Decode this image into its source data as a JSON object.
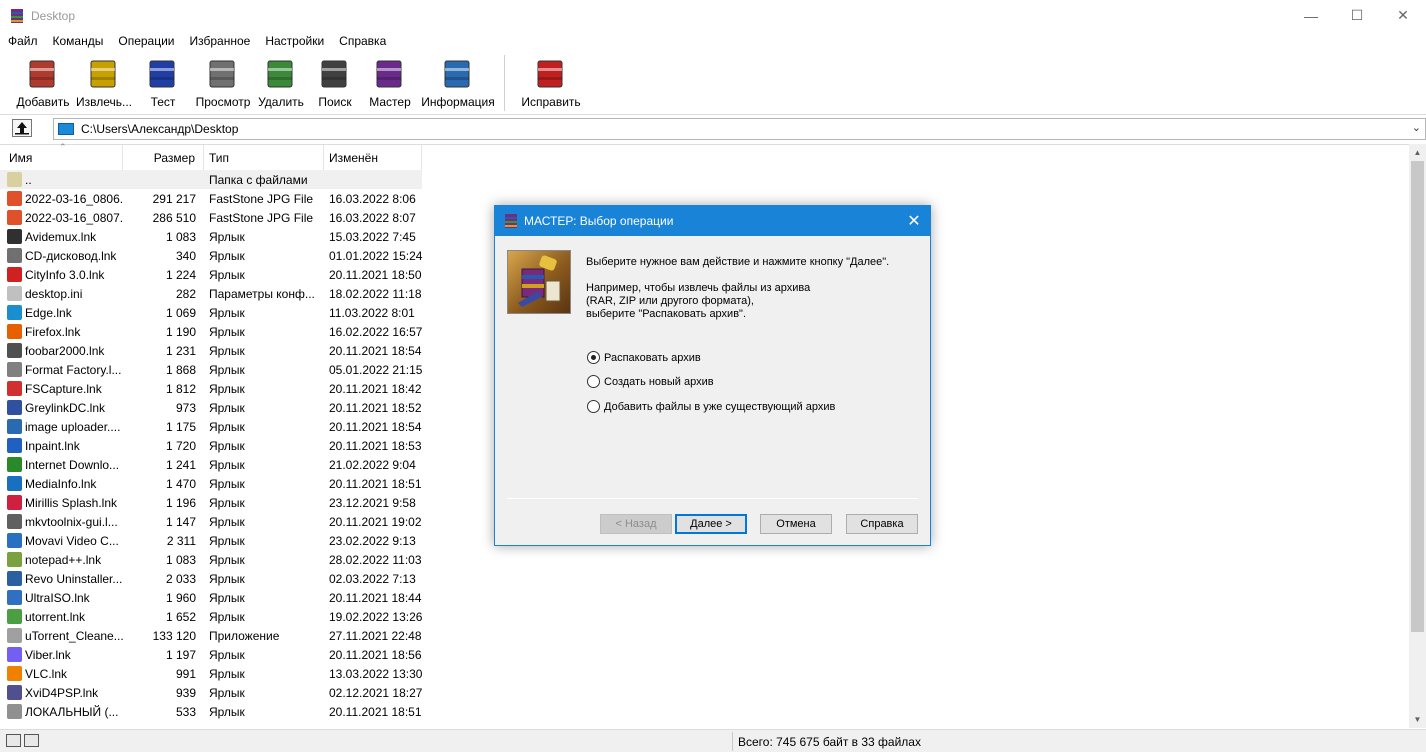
{
  "window": {
    "title": "Desktop",
    "minimize": "—",
    "maximize": "☐",
    "close": "✕"
  },
  "menu": [
    "Файл",
    "Команды",
    "Операции",
    "Избранное",
    "Настройки",
    "Справка"
  ],
  "toolbar": [
    {
      "label": "Добавить",
      "icon": "add-archive-icon",
      "color": "#b03a2e"
    },
    {
      "label": "Извлечь...",
      "icon": "extract-icon",
      "color": "#c8a000"
    },
    {
      "label": "Тест",
      "icon": "test-icon",
      "color": "#1f3fa6"
    },
    {
      "label": "Просмотр",
      "icon": "view-icon",
      "color": "#707070"
    },
    {
      "label": "Удалить",
      "icon": "delete-icon",
      "color": "#3a8a3a"
    },
    {
      "label": "Поиск",
      "icon": "find-icon",
      "color": "#404040"
    },
    {
      "label": "Мастер",
      "icon": "wizard-icon",
      "color": "#6a2a8a"
    },
    {
      "label": "Информация",
      "icon": "info-icon",
      "color": "#2a6ab0"
    },
    {
      "label": "Исправить",
      "icon": "repair-icon",
      "color": "#c02020"
    }
  ],
  "address": {
    "path": "C:\\Users\\Александр\\Desktop"
  },
  "columns": {
    "name": "Имя",
    "size": "Размер",
    "type": "Тип",
    "modified": "Изменён"
  },
  "files": [
    {
      "name": "..",
      "size": "",
      "type": "Папка с файлами",
      "modified": "",
      "color": "#d8d0a0"
    },
    {
      "name": "2022-03-16_0806...",
      "size": "291 217",
      "type": "FastStone JPG File",
      "modified": "16.03.2022 8:06",
      "color": "#e0502a"
    },
    {
      "name": "2022-03-16_0807...",
      "size": "286 510",
      "type": "FastStone JPG File",
      "modified": "16.03.2022 8:07",
      "color": "#e0502a"
    },
    {
      "name": "Avidemux.lnk",
      "size": "1 083",
      "type": "Ярлык",
      "modified": "15.03.2022 7:45",
      "color": "#303030"
    },
    {
      "name": "CD-дисковод.lnk",
      "size": "340",
      "type": "Ярлык",
      "modified": "01.01.2022 15:24",
      "color": "#707070"
    },
    {
      "name": "CityInfo 3.0.lnk",
      "size": "1 224",
      "type": "Ярлык",
      "modified": "20.11.2021 18:50",
      "color": "#d02020"
    },
    {
      "name": "desktop.ini",
      "size": "282",
      "type": "Параметры конф...",
      "modified": "18.02.2022 11:18",
      "color": "#c0c0c0"
    },
    {
      "name": "Edge.lnk",
      "size": "1 069",
      "type": "Ярлык",
      "modified": "11.03.2022 8:01",
      "color": "#1a8fd0"
    },
    {
      "name": "Firefox.lnk",
      "size": "1 190",
      "type": "Ярлык",
      "modified": "16.02.2022 16:57",
      "color": "#e66000"
    },
    {
      "name": "foobar2000.lnk",
      "size": "1 231",
      "type": "Ярлык",
      "modified": "20.11.2021 18:54",
      "color": "#505050"
    },
    {
      "name": "Format Factory.l...",
      "size": "1 868",
      "type": "Ярлык",
      "modified": "05.01.2022 21:15",
      "color": "#808080"
    },
    {
      "name": "FSCapture.lnk",
      "size": "1 812",
      "type": "Ярлык",
      "modified": "20.11.2021 18:42",
      "color": "#d03030"
    },
    {
      "name": "GreylinkDC.lnk",
      "size": "973",
      "type": "Ярлык",
      "modified": "20.11.2021 18:52",
      "color": "#3050a0"
    },
    {
      "name": "image uploader....",
      "size": "1 175",
      "type": "Ярлык",
      "modified": "20.11.2021 18:54",
      "color": "#2a6ab0"
    },
    {
      "name": "Inpaint.lnk",
      "size": "1 720",
      "type": "Ярлык",
      "modified": "20.11.2021 18:53",
      "color": "#1f60c0"
    },
    {
      "name": "Internet Downlo...",
      "size": "1 241",
      "type": "Ярлык",
      "modified": "21.02.2022 9:04",
      "color": "#2a8a2a"
    },
    {
      "name": "MediaInfo.lnk",
      "size": "1 470",
      "type": "Ярлык",
      "modified": "20.11.2021 18:51",
      "color": "#1a70c0"
    },
    {
      "name": "Mirillis Splash.lnk",
      "size": "1 196",
      "type": "Ярлык",
      "modified": "23.12.2021 9:58",
      "color": "#d02040"
    },
    {
      "name": "mkvtoolnix-gui.l...",
      "size": "1 147",
      "type": "Ярлык",
      "modified": "20.11.2021 19:02",
      "color": "#606060"
    },
    {
      "name": "Movavi Video C...",
      "size": "2 311",
      "type": "Ярлык",
      "modified": "23.02.2022 9:13",
      "color": "#2a70c0"
    },
    {
      "name": "notepad++.lnk",
      "size": "1 083",
      "type": "Ярлык",
      "modified": "28.02.2022 11:03",
      "color": "#7aa040"
    },
    {
      "name": "Revo Uninstaller....",
      "size": "2 033",
      "type": "Ярлык",
      "modified": "02.03.2022 7:13",
      "color": "#2a60a0"
    },
    {
      "name": "UltraISO.lnk",
      "size": "1 960",
      "type": "Ярлык",
      "modified": "20.11.2021 18:44",
      "color": "#3070c0"
    },
    {
      "name": "utorrent.lnk",
      "size": "1 652",
      "type": "Ярлык",
      "modified": "19.02.2022 13:26",
      "color": "#4aa040"
    },
    {
      "name": "uTorrent_Cleane...",
      "size": "133 120",
      "type": "Приложение",
      "modified": "27.11.2021 22:48",
      "color": "#a0a0a0"
    },
    {
      "name": "Viber.lnk",
      "size": "1 197",
      "type": "Ярлык",
      "modified": "20.11.2021 18:56",
      "color": "#7360f2"
    },
    {
      "name": "VLC.lnk",
      "size": "991",
      "type": "Ярлык",
      "modified": "13.03.2022 13:30",
      "color": "#f08000"
    },
    {
      "name": "XviD4PSP.lnk",
      "size": "939",
      "type": "Ярлык",
      "modified": "02.12.2021 18:27",
      "color": "#505090"
    },
    {
      "name": "ЛОКАЛЬНЫЙ (...",
      "size": "533",
      "type": "Ярлык",
      "modified": "20.11.2021 18:51",
      "color": "#909090"
    }
  ],
  "status": {
    "total": "Всего: 745 675 байт в 33 файлах"
  },
  "dialog": {
    "title": "МАСТЕР:  Выбор операции",
    "close": "✕",
    "intro": "Выберите нужное вам действие и нажмите кнопку \"Далее\".",
    "example": "Например, чтобы извлечь файлы из архива\n(RAR, ZIP или другого формата),\nвыберите \"Распаковать архив\".",
    "options": [
      {
        "label": "Распаковать архив",
        "selected": true
      },
      {
        "label": "Создать новый архив",
        "selected": false
      },
      {
        "label": "Добавить файлы в уже существующий архив",
        "selected": false
      }
    ],
    "buttons": {
      "back": "< Назад",
      "next": "Далее >",
      "cancel": "Отмена",
      "help": "Справка"
    }
  }
}
